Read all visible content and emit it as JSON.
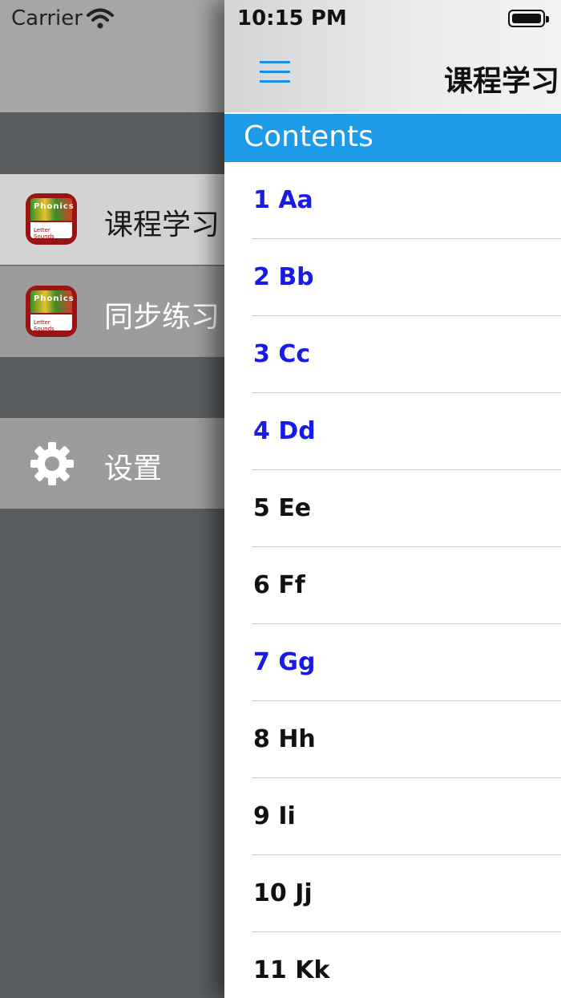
{
  "status_bar": {
    "carrier": "Carrier",
    "time": "10:15 PM"
  },
  "menu": {
    "items": [
      {
        "label": "课程学习",
        "icon": "phonics-app-icon",
        "icon_title": "Phonics",
        "icon_subtitle": "Letter Sounds",
        "selected": true
      },
      {
        "label": "同步练习",
        "icon": "phonics-app-icon",
        "icon_title": "Phonics",
        "icon_subtitle": "Letter Sounds",
        "selected": false
      },
      {
        "label": "设置",
        "icon": "gear-icon",
        "selected": false
      }
    ]
  },
  "navbar": {
    "title": "课程学习",
    "menu_icon": "hamburger-icon"
  },
  "contents_header": "Contents",
  "lessons": [
    {
      "label": "1 Aa",
      "visited": true
    },
    {
      "label": "2 Bb",
      "visited": true
    },
    {
      "label": "3 Cc",
      "visited": true
    },
    {
      "label": "4 Dd",
      "visited": true
    },
    {
      "label": "5 Ee",
      "visited": false
    },
    {
      "label": "6 Ff",
      "visited": false
    },
    {
      "label": "7 Gg",
      "visited": true
    },
    {
      "label": "8 Hh",
      "visited": false
    },
    {
      "label": "9 Ii",
      "visited": false
    },
    {
      "label": "10 Jj",
      "visited": false
    },
    {
      "label": "11 Kk",
      "visited": false
    }
  ],
  "colors": {
    "accent": "#1e9be8",
    "visited_link": "#1a1ae6",
    "normal_text": "#111111",
    "menu_bg": "#5b5e61"
  }
}
